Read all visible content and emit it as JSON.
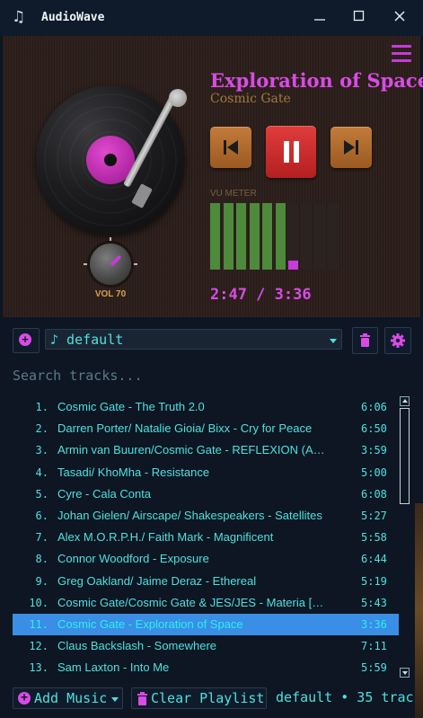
{
  "window": {
    "title": "AudioWave",
    "app_icon": "music-note-icon",
    "controls": [
      "minimize-icon",
      "maximize-icon",
      "close-icon"
    ]
  },
  "player": {
    "track_title": "Exploration of Space",
    "artist": "Cosmic Gate",
    "volume_label": "VOL 70",
    "volume": 70,
    "vu_label": "VU METER",
    "vu_levels": [
      1,
      1,
      1,
      1,
      1,
      1,
      0.14,
      0,
      0,
      0
    ],
    "time": "2:47 / 3:36",
    "state": "playing",
    "accent_color": "#d94be6",
    "button_color": "#b5702f",
    "pause_color": "#d12d2d"
  },
  "playlist": {
    "selected": "♪ default",
    "search_placeholder": "Search tracks..."
  },
  "tracks": [
    {
      "num": "1.",
      "title": "Cosmic Gate - The Truth 2.0",
      "duration": "6:06"
    },
    {
      "num": "2.",
      "title": "Darren Porter/ Natalie Gioia/ Bixx - Cry for Peace",
      "duration": "6:50"
    },
    {
      "num": "3.",
      "title": "Armin van Buuren/Cosmic Gate - REFLEXION (ASOT...",
      "duration": "3:59"
    },
    {
      "num": "4.",
      "title": "Tasadi/ KhoMha - Resistance",
      "duration": "5:00"
    },
    {
      "num": "5.",
      "title": "Cyre - Cala Conta",
      "duration": "6:08"
    },
    {
      "num": "6.",
      "title": "Johan Gielen/ Airscape/ Shakespeakers - Satellites",
      "duration": "5:27"
    },
    {
      "num": "7.",
      "title": "Alex M.O.R.P.H./ Faith Mark - Magnificent",
      "duration": "5:58"
    },
    {
      "num": "8.",
      "title": "Connor Woodford - Exposure",
      "duration": "6:44"
    },
    {
      "num": "9.",
      "title": "Greg Oakland/ Jaime Deraz - Ethereal",
      "duration": "5:19"
    },
    {
      "num": "10.",
      "title": "Cosmic Gate/Cosmic Gate & JES/JES - Materia [Mix ...",
      "duration": "5:43"
    },
    {
      "num": "11.",
      "title": "Cosmic Gate - Exploration of Space",
      "duration": "3:36",
      "selected": true
    },
    {
      "num": "12.",
      "title": "Claus Backslash - Somewhere",
      "duration": "7:11"
    },
    {
      "num": "13.",
      "title": "Sam Laxton - Into Me",
      "duration": "5:59"
    }
  ],
  "footer": {
    "add_music": "Add Music",
    "clear_playlist": "Clear Playlist",
    "status": "default • 35 trac"
  }
}
